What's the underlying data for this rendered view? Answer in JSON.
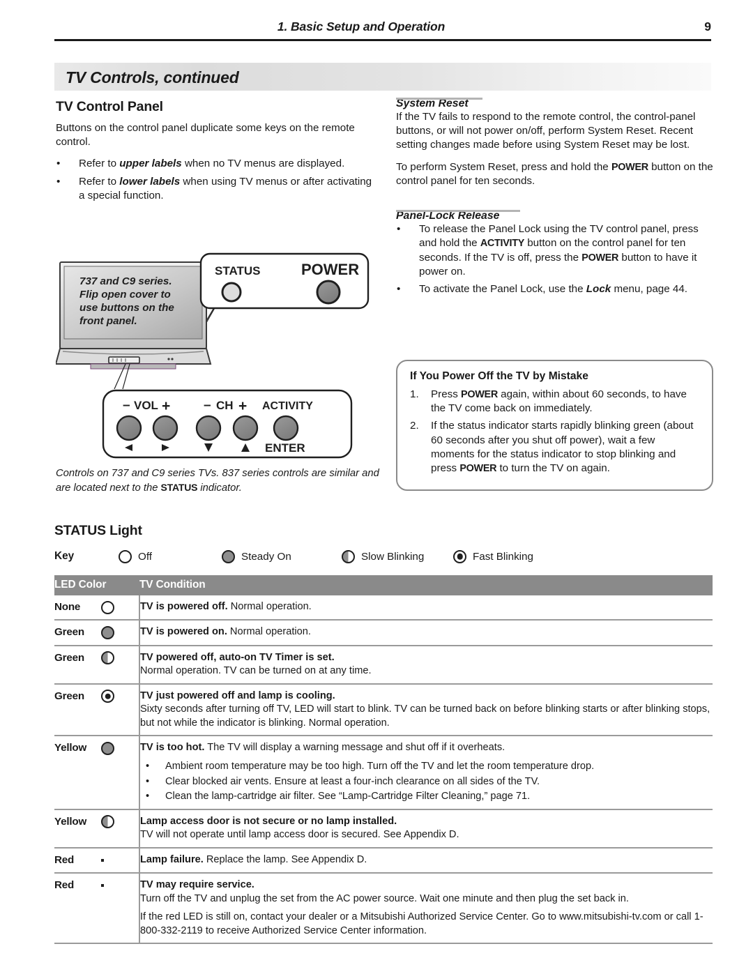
{
  "header": {
    "chapter": "1.  Basic Setup and Operation",
    "page_number": "9"
  },
  "banner": {
    "title": "TV Controls, continued"
  },
  "left_column": {
    "section_title": "TV Control Panel",
    "intro": "Buttons on the control panel duplicate some keys on the remote control.",
    "bullets": [
      {
        "bullet": "•",
        "pre": "Refer to ",
        "em": "upper labels",
        "post": " when no TV menus are displayed."
      },
      {
        "bullet": "•",
        "pre": "Refer to ",
        "em": "lower labels",
        "post": " when using TV menus or after activating a special function."
      }
    ],
    "illustration": {
      "tv_note": [
        "737 and C9 series.",
        "Flip open cover to",
        "use buttons on the",
        "front panel."
      ],
      "top_callout": {
        "status_label": "STATUS",
        "power_label": "POWER"
      },
      "bottom_callout": {
        "upper_labels": [
          "– VOL +",
          "– CH +",
          "ACTIVITY"
        ],
        "vol_minus": "–",
        "vol_text": "VOL",
        "vol_plus": "+",
        "ch_minus": "–",
        "ch_text": "CH",
        "ch_plus": "+",
        "activity": "ACTIVITY",
        "lower_labels": [
          "◄",
          "►",
          "▼",
          "▲",
          "ENTER"
        ],
        "enter": "ENTER"
      }
    },
    "caption": {
      "pre": "Controls on 737 and C9 series TVs.  837 series controls are similar and are located next to the ",
      "em": "STATUS",
      "post": " indicator."
    }
  },
  "right_column": {
    "system_reset": {
      "heading": "System Reset",
      "para1": "If the TV fails to respond to the remote control, the control-panel buttons, or will not power on/off, perform System Reset.  Recent setting changes made before using System Reset may be lost.",
      "para2_pre": "To perform System Reset, press and hold the ",
      "para2_em": "POWER",
      "para2_post": " button on the control panel for ten seconds."
    },
    "panel_lock": {
      "heading": "Panel-Lock Release",
      "bullets": [
        {
          "bullet": "•",
          "p1": "To release the Panel Lock using the TV control panel, press and hold the ",
          "e1": "ACTIVITY",
          "p2": " button on the control panel for ten seconds.  If the TV is off, press the ",
          "e2": "POWER",
          "p3": " button to have it power on."
        },
        {
          "bullet": "•",
          "p1": "To activate the Panel Lock, use the ",
          "e1": "Lock",
          "p2": " menu, page 44.",
          "e2": "",
          "p3": ""
        }
      ]
    },
    "note_box": {
      "title": "If You Power Off the TV by Mistake",
      "items": [
        {
          "num": "1.",
          "p1": "Press ",
          "e1": "POWER",
          "p2": " again, within about 60 seconds, to have the TV come back on immediately.",
          "e2": "",
          "p3": ""
        },
        {
          "num": "2.",
          "p1": "If the status indicator starts rapidly blinking green (about 60 seconds after you shut off power), wait a few moments for the status indicator to stop blinking and press ",
          "e1": "POWER",
          "p2": " to turn the TV on again.",
          "e2": "",
          "p3": ""
        }
      ]
    }
  },
  "status_light": {
    "title": "STATUS Light",
    "key_label": "Key",
    "key_items": [
      {
        "icon": "led-off-icon",
        "label": "Off"
      },
      {
        "icon": "led-steady-on-icon",
        "label": "Steady On"
      },
      {
        "icon": "led-slow-blinking-icon",
        "label": "Slow Blinking"
      },
      {
        "icon": "led-fast-blinking-icon",
        "label": "Fast Blinking"
      }
    ],
    "table": {
      "columns": [
        "LED Color",
        "TV Condition"
      ],
      "rows": [
        {
          "color": "None",
          "icon": "led-off-icon",
          "lead": "TV is powered off.",
          "rest": "  Normal operation.",
          "extra": "",
          "bullets": []
        },
        {
          "color": "Green",
          "icon": "led-steady-on-icon",
          "lead": "TV is powered on.",
          "rest": "  Normal operation.",
          "extra": "",
          "bullets": []
        },
        {
          "color": "Green",
          "icon": "led-slow-blinking-icon",
          "lead": "TV powered off, auto-on TV Timer is set.",
          "rest": "",
          "extra": "Normal operation.  TV can be turned on at any time.",
          "bullets": []
        },
        {
          "color": "Green",
          "icon": "led-fast-blinking-icon",
          "lead": "TV just powered off and lamp is cooling.",
          "rest": "",
          "extra": "Sixty seconds after turning off TV, LED will start to blink.  TV can be turned back on before blinking starts or after blinking stops, but not while the indicator is blinking.  Normal operation.",
          "bullets": []
        },
        {
          "color": "Yellow",
          "icon": "led-steady-on-icon",
          "lead": "TV is too hot.",
          "rest": "  The TV will display a warning message and shut off if it overheats.",
          "extra": "",
          "bullets": [
            "Ambient room temperature may be too high.  Turn off the TV and let the room temperature drop.",
            "Clear blocked air vents.  Ensure at least a four-inch clearance on all sides of the TV.",
            "Clean the lamp-cartridge air filter.  See “Lamp-Cartridge Filter Cleaning,” page 71."
          ]
        },
        {
          "color": "Yellow",
          "icon": "led-slow-blinking-icon",
          "lead": "Lamp access door is not secure or no lamp installed.",
          "rest": "",
          "extra": "TV will not operate until lamp access door is secured.  See Appendix D.",
          "bullets": []
        },
        {
          "color": "Red",
          "icon": "led-steady-on-dark-icon",
          "lead": "Lamp failure.",
          "rest": "  Replace the lamp.  See Appendix D.",
          "extra": "",
          "bullets": []
        },
        {
          "color": "Red",
          "icon": "led-slow-blinking-dark-icon",
          "lead": "TV may require service.",
          "rest": "",
          "extra": "Turn off the TV and unplug the set from the AC power source.  Wait one minute and then plug the set back in.",
          "extra2": "If the red LED is still on, contact your dealer or a Mitsubishi Authorized Service Center.  Go to www.mitsubishi-tv.com or call 1-800-332-2119 to receive Authorized Service Center information.",
          "bullets": []
        }
      ]
    }
  }
}
